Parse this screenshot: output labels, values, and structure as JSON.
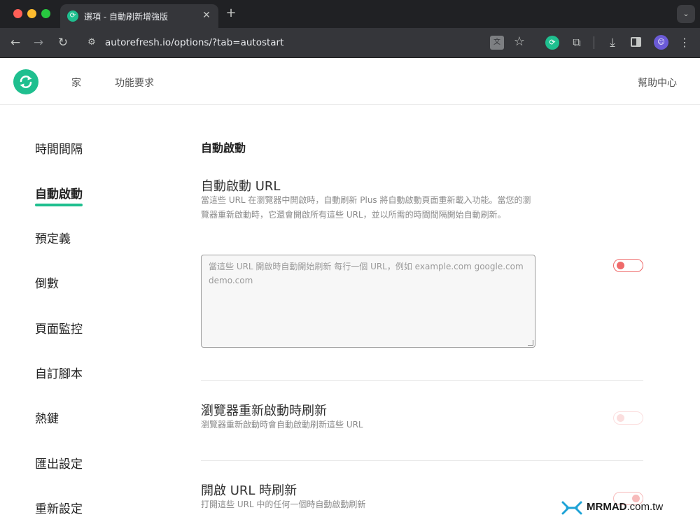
{
  "browser": {
    "tab_title": "選項 - 自動刷新增強版",
    "tab_close": "✕",
    "new_tab": "+",
    "url": "autorefresh.io/options/?tab=autostart",
    "icons": [
      "back-icon",
      "forward-icon",
      "reload-icon",
      "site-settings-icon",
      "translate-icon",
      "star-icon",
      "extension-refresh-icon",
      "puzzle-icon",
      "download-icon",
      "side-panel-icon",
      "avatar",
      "menu-icon"
    ]
  },
  "header": {
    "nav": [
      "家",
      "功能要求"
    ],
    "help": "幫助中心"
  },
  "sidebar": {
    "items": [
      {
        "label": "時間間隔"
      },
      {
        "label": "自動啟動",
        "active": true
      },
      {
        "label": "預定義"
      },
      {
        "label": "倒數"
      },
      {
        "label": "頁面監控"
      },
      {
        "label": "自訂腳本"
      },
      {
        "label": "熱鍵"
      },
      {
        "label": "匯出設定"
      },
      {
        "label": "重新設定"
      }
    ]
  },
  "main": {
    "section_title": "自動啟動",
    "settings": [
      {
        "title": "自動啟動 URL",
        "desc": "當這些 URL 在瀏覽器中開啟時，自動刷新 Plus 將自動啟動頁面重新載入功能。當您的瀏覽器重新啟動時，它還會開啟所有這些 URL，並以所需的時間間隔開始自動刷新。",
        "placeholder": "當這些 URL 開啟時自動開始刷新 每行一個 URL，例如 example.com google.com demo.com",
        "value": "",
        "toggle": "off"
      },
      {
        "title": "瀏覽器重新啟動時刷新",
        "desc": "瀏覽器重新啟動時會自動啟動刷新這些 URL",
        "toggle": "off"
      },
      {
        "title": "開啟 URL 時刷新",
        "desc": "打開這些 URL 中的任何一個時自動啟動刷新",
        "toggle": "on"
      }
    ]
  },
  "watermark": {
    "brand": "MRMAD",
    "suffix": ".com.tw"
  },
  "colors": {
    "accent": "#1fbf8f",
    "toggle": "#ef6b6b",
    "chrome_dark": "#202124",
    "chrome_toolbar": "#35363a"
  }
}
